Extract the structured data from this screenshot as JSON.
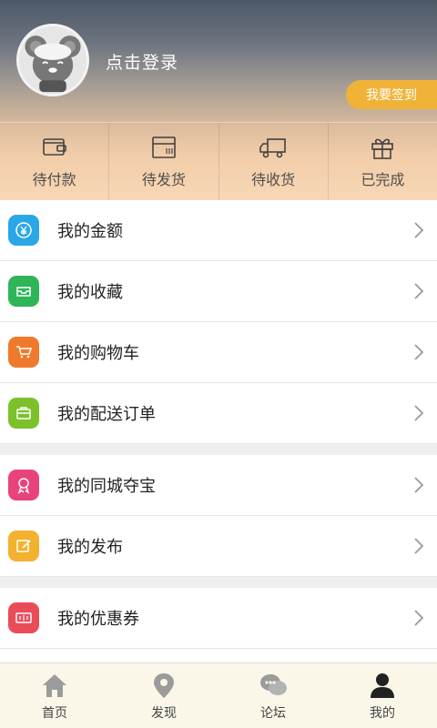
{
  "header": {
    "login_text": "点击登录",
    "checkin_label": "我要签到",
    "checkin_color": "#f0b338"
  },
  "orders": [
    {
      "label": "待付款",
      "icon": "wallet-icon"
    },
    {
      "label": "待发货",
      "icon": "package-icon"
    },
    {
      "label": "待收货",
      "icon": "truck-icon"
    },
    {
      "label": "已完成",
      "icon": "gift-icon"
    }
  ],
  "menu": [
    {
      "label": "我的金额",
      "icon": "yuan-icon",
      "color": "#2aa7e6"
    },
    {
      "label": "我的收藏",
      "icon": "inbox-icon",
      "color": "#2fb45a"
    },
    {
      "label": "我的购物车",
      "icon": "cart-icon",
      "color": "#f07a2c"
    },
    {
      "label": "我的配送订单",
      "icon": "briefcase-icon",
      "color": "#7cc12b"
    },
    {
      "label": "我的同城夺宝",
      "icon": "award-icon",
      "color": "#e9437c"
    },
    {
      "label": "我的发布",
      "icon": "edit-icon",
      "color": "#f3b12f"
    },
    {
      "label": "我的优惠券",
      "icon": "coupon-icon",
      "color": "#ea4d59"
    }
  ],
  "tabbar": [
    {
      "label": "首页",
      "icon": "home-icon"
    },
    {
      "label": "发现",
      "icon": "location-icon"
    },
    {
      "label": "论坛",
      "icon": "chat-icon"
    },
    {
      "label": "我的",
      "icon": "user-icon"
    }
  ]
}
